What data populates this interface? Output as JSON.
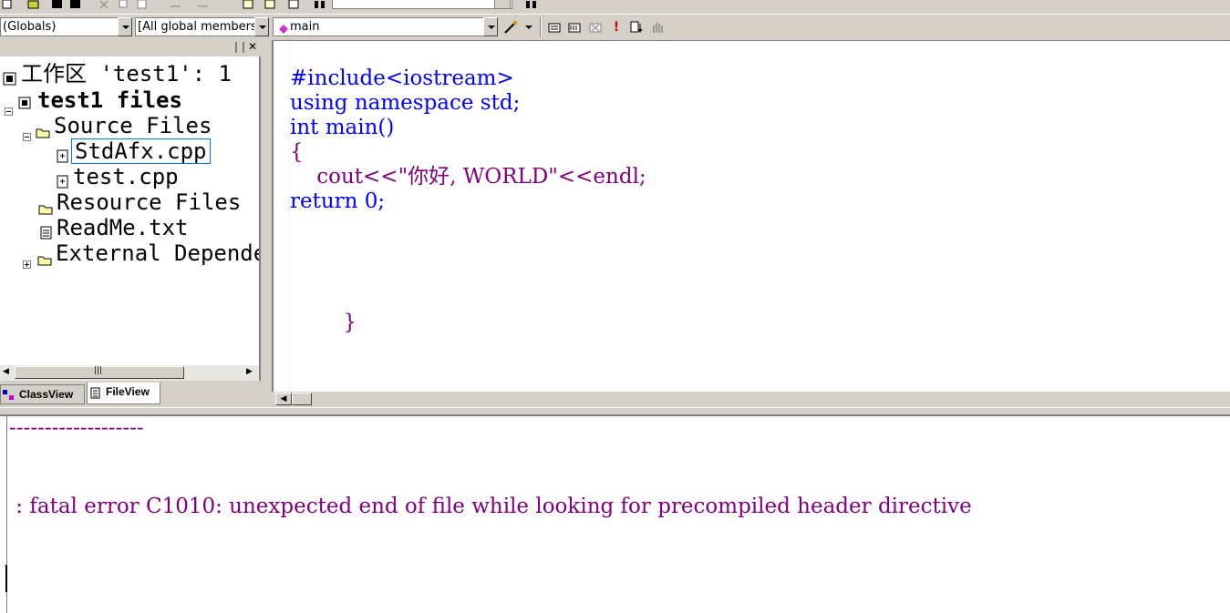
{
  "toolbar_top": {
    "find_field": ""
  },
  "toolbar_wizard": {
    "class_combo": "(Globals)",
    "members_combo": "[All global members",
    "function_combo": "main"
  },
  "workspace": {
    "root_label": "工作区 'test1': 1 ",
    "project_label": "test1 files",
    "items": [
      {
        "label": "Source Files",
        "icon": "folder-open-icon"
      },
      {
        "label": "StdAfx.cpp",
        "icon": "cpp-file-icon",
        "selected": true
      },
      {
        "label": "test.cpp",
        "icon": "cpp-file-icon"
      },
      {
        "label": "Resource Files",
        "icon": "folder-icon"
      },
      {
        "label": "ReadMe.txt",
        "icon": "text-file-icon"
      },
      {
        "label": "External Depende",
        "icon": "folder-icon"
      }
    ],
    "scroll_marker": "|||",
    "tabs": [
      {
        "label": "ClassView",
        "active": false
      },
      {
        "label": "FileView",
        "active": true
      }
    ]
  },
  "editor": {
    "lines": [
      {
        "text": "#include<iostream>",
        "color": "#0000ff"
      },
      {
        "text": "using namespace std;",
        "color": "#0000ff"
      },
      {
        "text": "int main()",
        "color": "#0000ff"
      },
      {
        "text": "{",
        "color": "#800080"
      },
      {
        "text": "    cout<<\"你好, WORLD\"<<endl;",
        "color": "#800080"
      },
      {
        "text": "return 0;",
        "color": "#0000ff"
      },
      {
        "text": "        }",
        "color": "#800080"
      }
    ]
  },
  "output": {
    "separator": "-------------------",
    "error": " : fatal error C1010: unexpected end of file while looking for precompiled header directive"
  },
  "colors": {
    "keyword": "#0000ff",
    "text": "#800080",
    "chrome": "#d4d0c8"
  }
}
